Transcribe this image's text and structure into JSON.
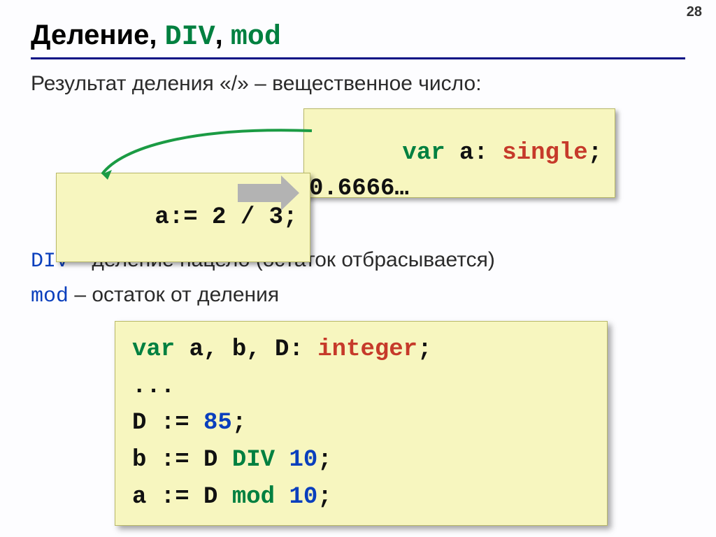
{
  "page_number": "28",
  "title": {
    "word": "Деление",
    "kw1": "DIV",
    "kw2": "mod"
  },
  "intro": "Результат деления «/» – вещественное число:",
  "box_decl": {
    "kw": "var",
    "rest": " a: ",
    "type": "single",
    "semi": ";"
  },
  "box_expr": "a:= 2 / 3;",
  "box_result": "0.6666…",
  "div_line": {
    "kw": "DIV",
    "rest": " – деление нацело (остаток отбрасывается)"
  },
  "mod_line": {
    "kw": "mod",
    "rest": " – остаток от деления"
  },
  "block2": {
    "l1_kw": "var",
    "l1_mid": " a, b, D: ",
    "l1_type": "integer",
    "l1_semi": ";",
    "l2": "...",
    "l3_left": "D := ",
    "l3_num": "85",
    "l3_semi": ";",
    "l4_left": "b := D ",
    "l4_kw": "DIV",
    "l4_sp": " ",
    "l4_num": "10",
    "l4_semi": ";",
    "l5_left": "a := D ",
    "l5_kw": "mod",
    "l5_sp": " ",
    "l5_num": "10",
    "l5_semi": ";"
  }
}
